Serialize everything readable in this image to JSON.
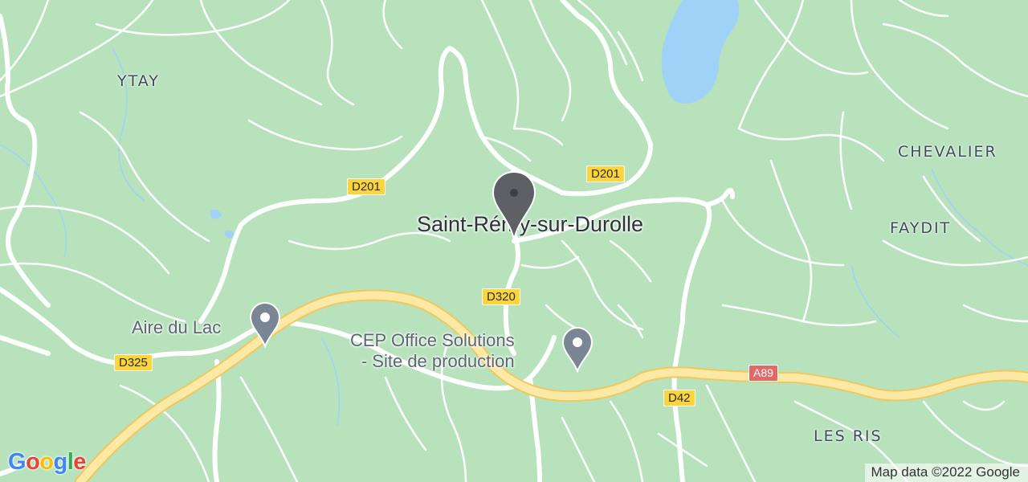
{
  "map": {
    "place_labels": {
      "ytay": "YTAY",
      "chevalier": "CHEVALIER",
      "faydit": "FAYDIT",
      "les_ris": "LES RIS"
    },
    "town_label": "Saint-Rémy-sur-Durolle",
    "pois": {
      "aire_du_lac": "Aire du Lac",
      "cep_line1": "CEP Office Solutions",
      "cep_line2": "- Site de production"
    },
    "road_shields": {
      "d201_west": "D201",
      "d201_east": "D201",
      "d320": "D320",
      "d325": "D325",
      "d42": "D42",
      "a89": "A89"
    },
    "attribution": "Map data ©2022 Google",
    "logo_letters": [
      "G",
      "o",
      "o",
      "g",
      "l",
      "e"
    ],
    "colors": {
      "land": "#b7e2bc",
      "water": "#9fd2f6",
      "road": "#ffffff",
      "highway": "#fbe39a",
      "marker_pin": "#5d6064",
      "poi_pin": "#7a8693",
      "shield_departmental": "#fcd43b",
      "shield_autoroute": "#e06a6a",
      "logo_colors": [
        "#4285F4",
        "#EA4335",
        "#FBBC05",
        "#4285F4",
        "#34A853",
        "#EA4335"
      ]
    },
    "icons": [
      "location-pin-icon",
      "poi-pin-icon"
    ]
  }
}
